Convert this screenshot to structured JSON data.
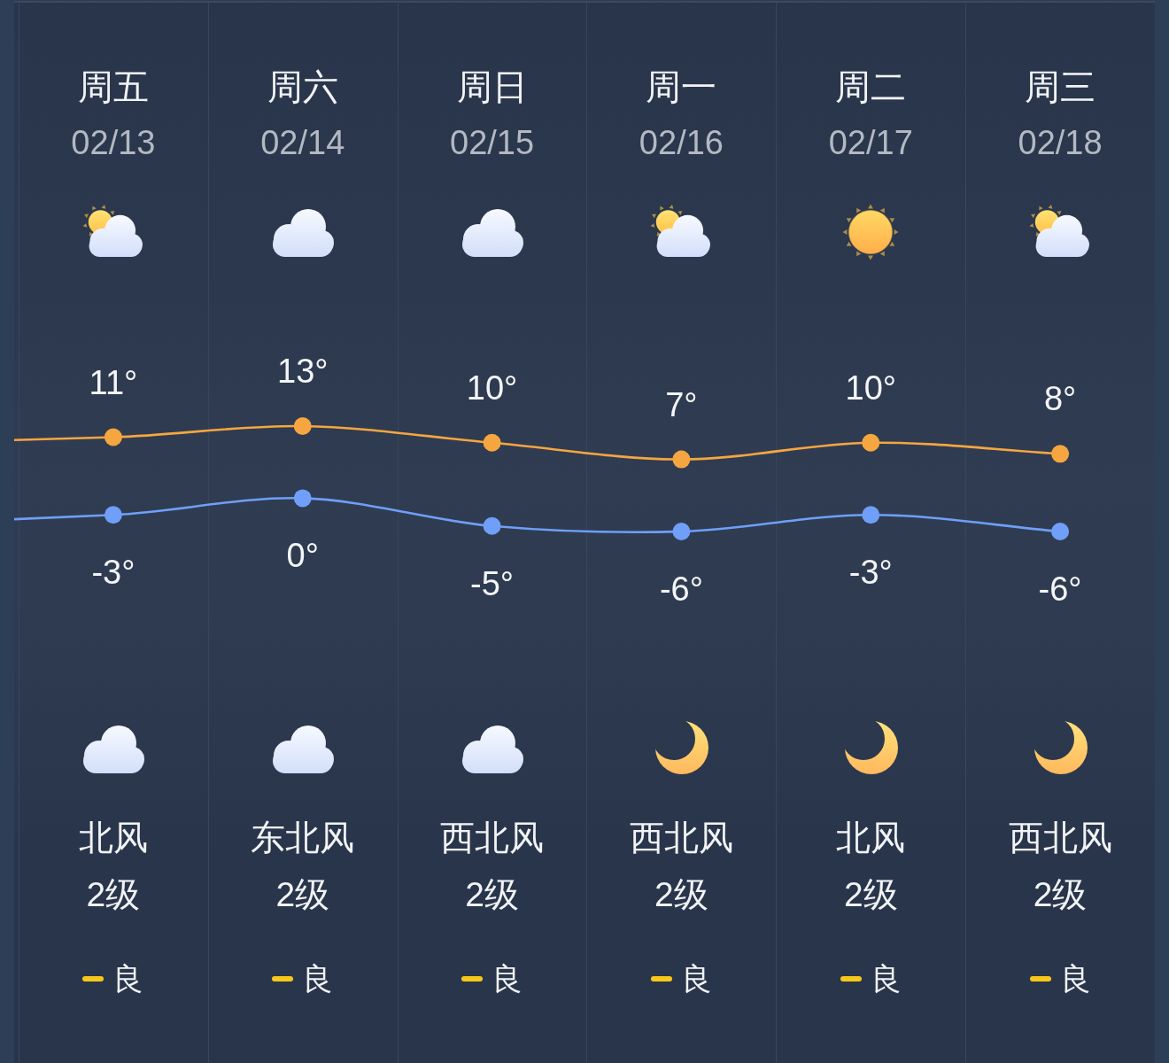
{
  "forecast": {
    "days": [
      {
        "weekday": "周五",
        "date": "02/13",
        "day_weather": {
          "kind": "partly_cloudy"
        },
        "high_temperature": "11°",
        "low_temperature": "-3°",
        "night_weather": {
          "kind": "cloudy"
        },
        "wind_direction": "北风",
        "wind_level": "2级",
        "air_quality": "良"
      },
      {
        "weekday": "周六",
        "date": "02/14",
        "day_weather": {
          "kind": "cloudy"
        },
        "high_temperature": "13°",
        "low_temperature": "0°",
        "night_weather": {
          "kind": "cloudy"
        },
        "wind_direction": "东北风",
        "wind_level": "2级",
        "air_quality": "良"
      },
      {
        "weekday": "周日",
        "date": "02/15",
        "day_weather": {
          "kind": "cloudy"
        },
        "high_temperature": "10°",
        "low_temperature": "-5°",
        "night_weather": {
          "kind": "cloudy"
        },
        "wind_direction": "西北风",
        "wind_level": "2级",
        "air_quality": "良"
      },
      {
        "weekday": "周一",
        "date": "02/16",
        "day_weather": {
          "kind": "partly_cloudy"
        },
        "high_temperature": "7°",
        "low_temperature": "-6°",
        "night_weather": {
          "kind": "clear_night"
        },
        "wind_direction": "西北风",
        "wind_level": "2级",
        "air_quality": "良"
      },
      {
        "weekday": "周二",
        "date": "02/17",
        "day_weather": {
          "kind": "sunny"
        },
        "high_temperature": "10°",
        "low_temperature": "-3°",
        "night_weather": {
          "kind": "clear_night"
        },
        "wind_direction": "北风",
        "wind_level": "2级",
        "air_quality": "良"
      },
      {
        "weekday": "周三",
        "date": "02/18",
        "day_weather": {
          "kind": "partly_cloudy"
        },
        "high_temperature": "8°",
        "low_temperature": "-6°",
        "night_weather": {
          "kind": "clear_night"
        },
        "wind_direction": "西北风",
        "wind_level": "2级",
        "air_quality": "良"
      }
    ]
  }
}
